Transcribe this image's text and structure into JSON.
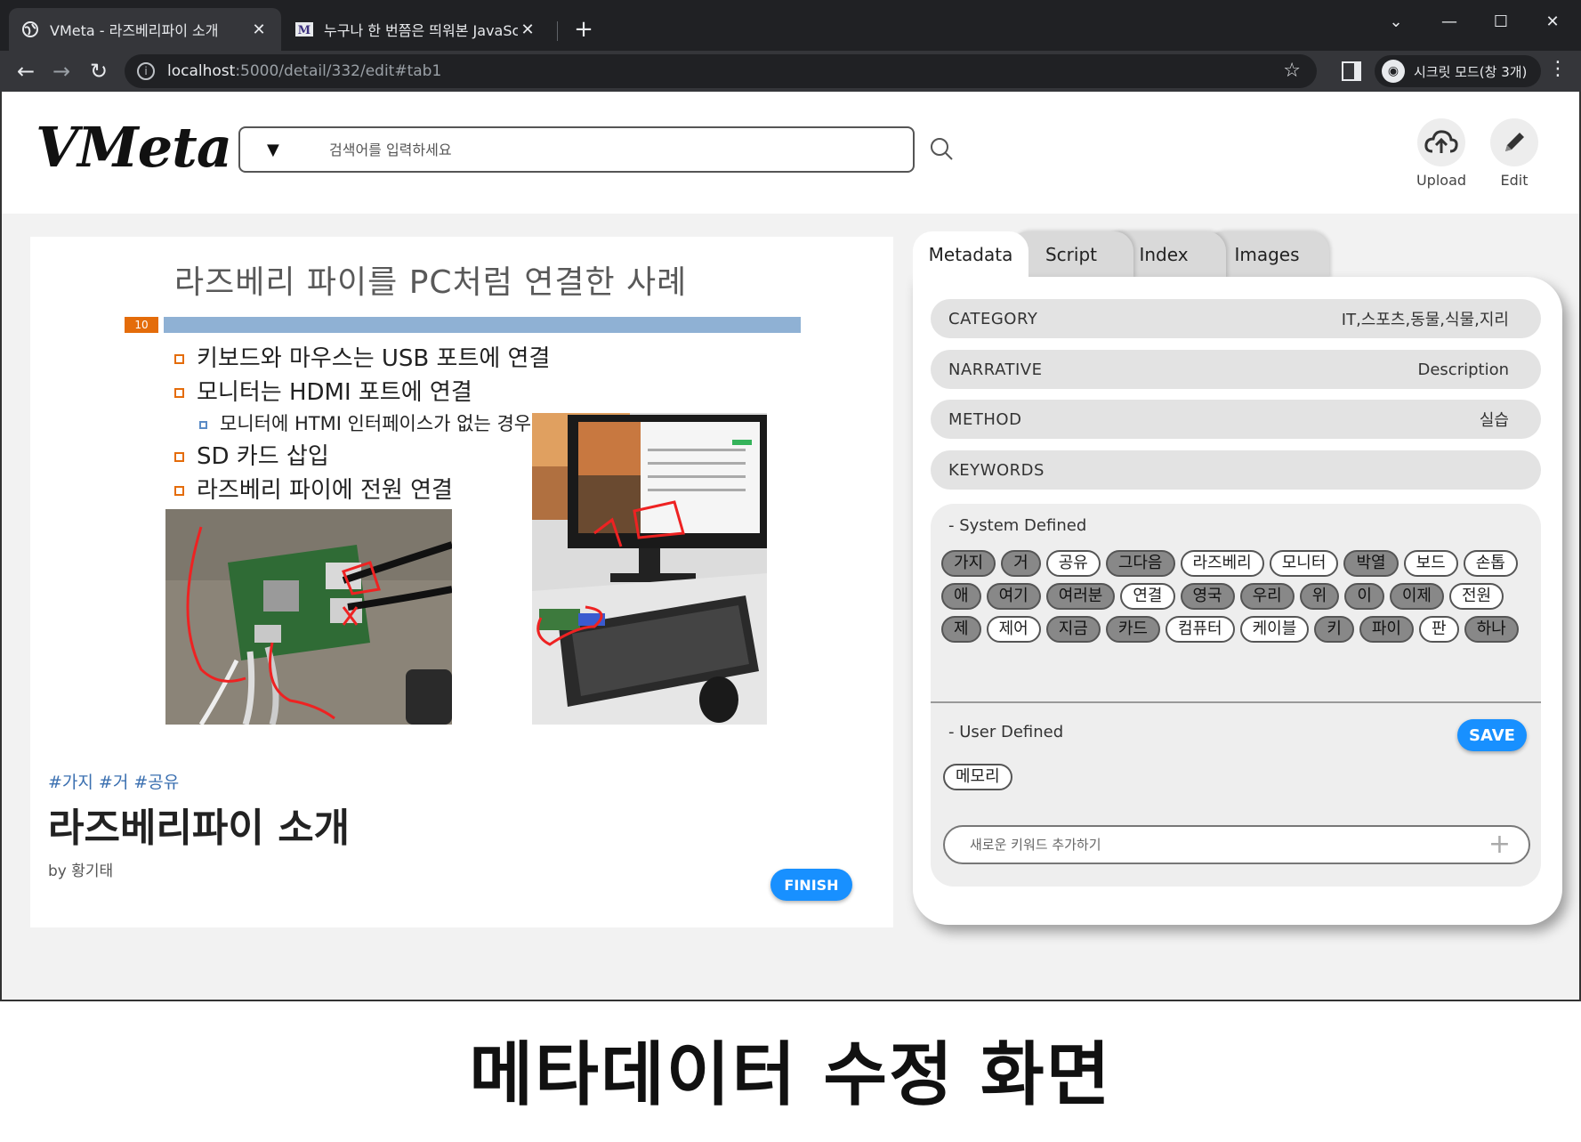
{
  "browser": {
    "tabs": [
      {
        "title": "VMeta - 라즈베리파이 소개",
        "active": true
      },
      {
        "title": "누구나 한 번쯤은 띄워본 JavaScr",
        "active": false
      }
    ],
    "new_tab": "+",
    "url_host": "localhost",
    "url_path": ":5000/detail/332/edit#tab1",
    "incognito_label": "시크릿 모드(창 3개)",
    "window_controls": [
      "⌄",
      "—",
      "☐",
      "✕"
    ]
  },
  "header": {
    "logo": "VMeta",
    "search_placeholder": "검색어를 입력하세요",
    "dropdown_symbol": "▼",
    "actions": [
      {
        "label": "Upload",
        "icon": "cloud-upload-icon"
      },
      {
        "label": "Edit",
        "icon": "pencil-icon"
      }
    ]
  },
  "slide": {
    "title": "라즈베리 파이를 PC처럼 연결한 사례",
    "number": "10",
    "bullets": [
      {
        "text": "키보드와 마우스는 USB 포트에 연결",
        "level": 1
      },
      {
        "text": "모니터는 HDMI 포트에 연결",
        "level": 1
      },
      {
        "text": "모니터에 HTMI 인터페이스가 없는 경우 젠더 사용 필요",
        "level": 2
      },
      {
        "text": "SD 카드 삽입",
        "level": 1
      },
      {
        "text": "라즈베리 파이에 전원 연결",
        "level": 1
      }
    ]
  },
  "document": {
    "hashtags": "#가지 #거 #공유",
    "title": "라즈베리파이 소개",
    "author": "by 황기태",
    "finish_label": "FINISH"
  },
  "metadata": {
    "tabs": [
      "Metadata",
      "Script",
      "Index",
      "Images"
    ],
    "active_tab": "Metadata",
    "fields": [
      {
        "key": "CATEGORY",
        "value": "IT,스포츠,동물,식물,지리"
      },
      {
        "key": "NARRATIVE",
        "value": "Description"
      },
      {
        "key": "METHOD",
        "value": "실습"
      },
      {
        "key": "KEYWORDS",
        "value": ""
      }
    ],
    "system_defined_title": "- System Defined",
    "system_keywords": [
      {
        "text": "가지",
        "selected": true
      },
      {
        "text": "거",
        "selected": true
      },
      {
        "text": "공유",
        "selected": false
      },
      {
        "text": "그다음",
        "selected": true
      },
      {
        "text": "라즈베리",
        "selected": false
      },
      {
        "text": "모니터",
        "selected": false
      },
      {
        "text": "박열",
        "selected": true
      },
      {
        "text": "보드",
        "selected": false
      },
      {
        "text": "손톱",
        "selected": false
      },
      {
        "text": "애",
        "selected": true
      },
      {
        "text": "여기",
        "selected": true
      },
      {
        "text": "여러분",
        "selected": true
      },
      {
        "text": "연결",
        "selected": false
      },
      {
        "text": "영국",
        "selected": true
      },
      {
        "text": "우리",
        "selected": true
      },
      {
        "text": "위",
        "selected": true
      },
      {
        "text": "이",
        "selected": true
      },
      {
        "text": "이제",
        "selected": true
      },
      {
        "text": "전원",
        "selected": false
      },
      {
        "text": "제",
        "selected": true
      },
      {
        "text": "제어",
        "selected": false
      },
      {
        "text": "지금",
        "selected": true
      },
      {
        "text": "카드",
        "selected": true
      },
      {
        "text": "컴퓨터",
        "selected": false
      },
      {
        "text": "케이블",
        "selected": false
      },
      {
        "text": "키",
        "selected": true
      },
      {
        "text": "파이",
        "selected": true
      },
      {
        "text": "판",
        "selected": false
      },
      {
        "text": "하나",
        "selected": true
      }
    ],
    "user_defined_title": "- User Defined",
    "save_label": "SAVE",
    "user_keywords": [
      "메모리"
    ],
    "add_keyword_placeholder": "새로운 키워드 추가하기",
    "add_symbol": "+"
  },
  "caption": "메타데이터 수정 화면",
  "colors": {
    "accent": "#1890ff",
    "slide_orange": "#e46c0a",
    "slide_bar": "#8fb1d4",
    "hashtag": "#3a6fb0"
  }
}
